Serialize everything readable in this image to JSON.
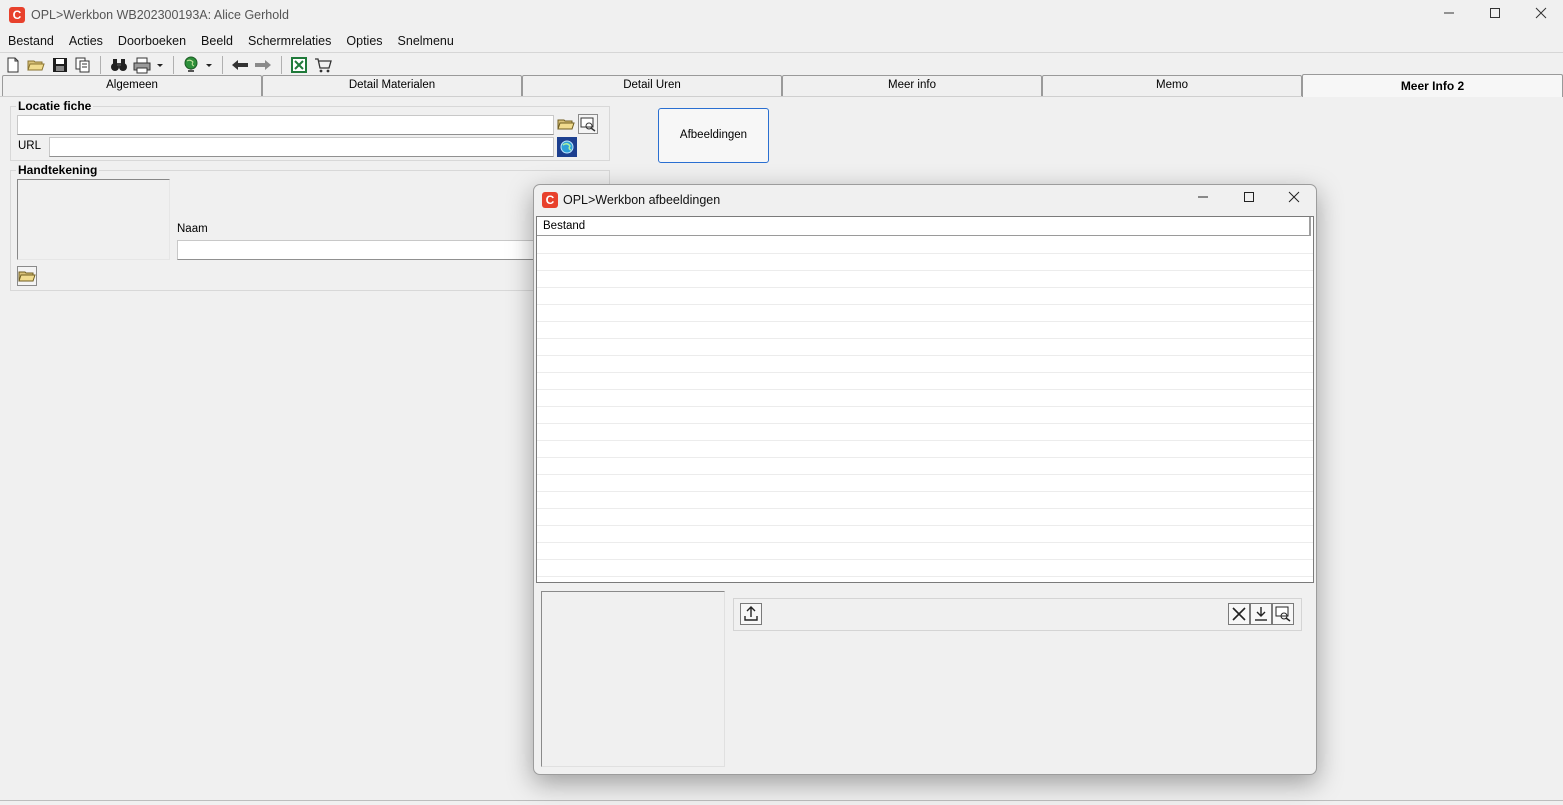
{
  "window": {
    "title": "OPL>Werkbon WB202300193A: Alice Gerhold",
    "logo_letter": "C",
    "minimize_icon": "minimize-icon",
    "maximize_icon": "maximize-icon",
    "close_icon": "close-icon"
  },
  "menu": [
    "Bestand",
    "Acties",
    "Doorboeken",
    "Beeld",
    "Schermrelaties",
    "Opties",
    "Snelmenu"
  ],
  "toolbar": {
    "icons": [
      "new-document-icon",
      "open-folder-icon",
      "save-icon",
      "copy-icon",
      "binoculars-icon",
      "print-icon",
      "globe-icon",
      "arrow-left-icon",
      "arrow-right-icon",
      "excel-icon",
      "cart-icon"
    ]
  },
  "tabs": [
    "Algemeen",
    "Detail Materialen",
    "Detail Uren",
    "Meer info",
    "Memo",
    "Meer Info 2"
  ],
  "active_tab": "Meer Info 2",
  "locatie": {
    "title": "Locatie fiche",
    "path_value": "",
    "url_label": "URL",
    "url_value": ""
  },
  "handtekening": {
    "title": "Handtekening",
    "naam_label": "Naam",
    "naam_value": ""
  },
  "afbeeldingen_button": "Afbeeldingen",
  "dialog": {
    "title": "OPL>Werkbon afbeeldingen",
    "logo_letter": "C",
    "column_header": "Bestand",
    "rows": [],
    "toolbar_icons": [
      "upload-icon",
      "delete-icon",
      "download-icon",
      "preview-icon"
    ]
  },
  "colors": {
    "brand": "#e8412c",
    "focus_border": "#2a6fd1",
    "background": "#f0f0f0"
  }
}
